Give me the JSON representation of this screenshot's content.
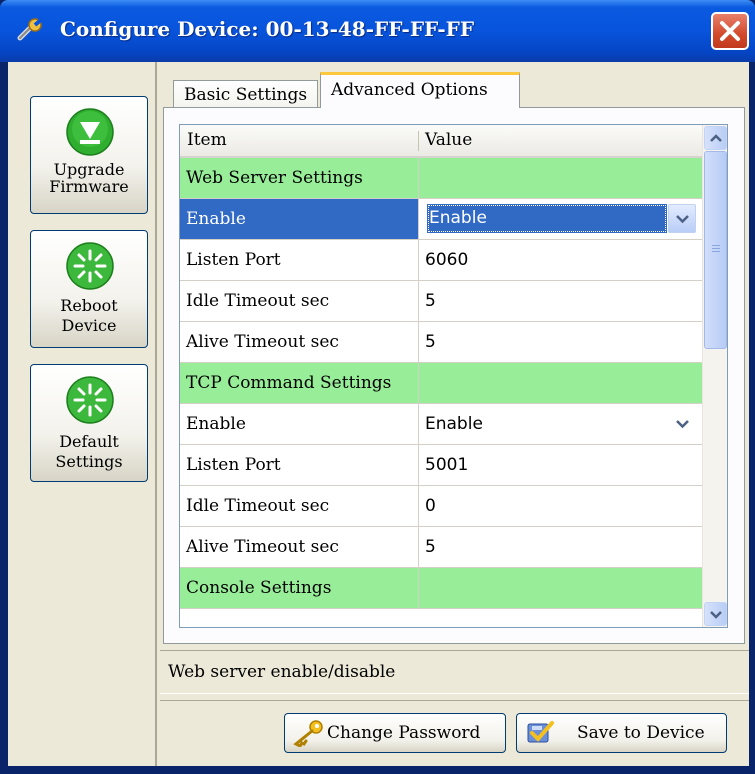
{
  "window": {
    "title": "Configure Device: 00-13-48-FF-FF-FF"
  },
  "sidebar": {
    "upgrade": {
      "line1": "Upgrade",
      "line2": "Firmware"
    },
    "reboot": {
      "line1": "Reboot",
      "line2": "Device"
    },
    "defaults": {
      "line1": "Default",
      "line2": "Settings"
    }
  },
  "tabs": {
    "basic": "Basic Settings",
    "advanced": "Advanced Options"
  },
  "grid": {
    "headers": {
      "item": "Item",
      "value": "Value"
    },
    "rows": [
      {
        "item": "Web Server Settings",
        "value": ""
      },
      {
        "item": "Enable",
        "value": "Enable"
      },
      {
        "item": "Listen Port",
        "value": "6060"
      },
      {
        "item": "Idle Timeout sec",
        "value": "5"
      },
      {
        "item": "Alive Timeout sec",
        "value": "5"
      },
      {
        "item": "TCP Command Settings",
        "value": ""
      },
      {
        "item": "Enable",
        "value": "Enable"
      },
      {
        "item": "Listen Port",
        "value": "5001"
      },
      {
        "item": "Idle Timeout sec",
        "value": "0"
      },
      {
        "item": "Alive Timeout sec",
        "value": "5"
      },
      {
        "item": "Console Settings",
        "value": ""
      }
    ]
  },
  "status": {
    "text": "Web server enable/disable"
  },
  "buttons": {
    "change_password": "Change Password",
    "save": "Save to Device"
  },
  "colors": {
    "section_row": "#98ee98",
    "selection": "#316ac5",
    "titlebar": "#0854dc"
  }
}
